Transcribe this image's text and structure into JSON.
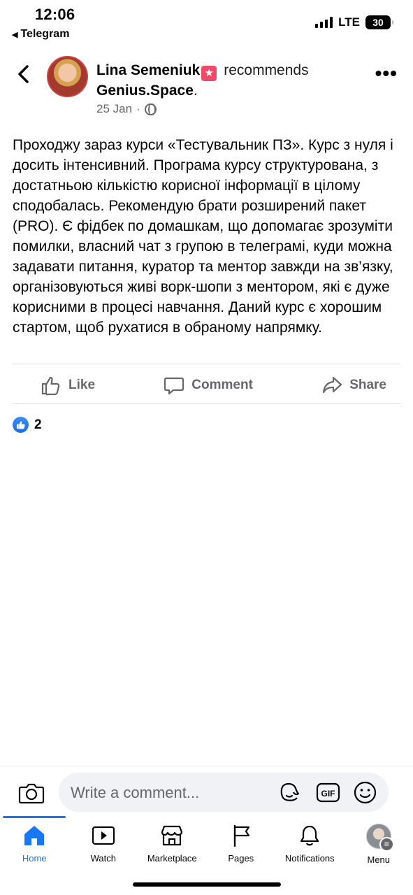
{
  "status_bar": {
    "time": "12:06",
    "back_app": "Telegram",
    "network": "LTE",
    "battery": "30"
  },
  "post": {
    "author": "Lina Semeniuk",
    "action_text": "recommends",
    "page_name": "Genius.Space",
    "date": "25 Jan",
    "separator": "·",
    "body": "Проходжу зараз курси «Тестувальник ПЗ». Курс з нуля і досить інтенсивний. Програма курсу структурована, з достатньою кількістю корисної інформації в цілому сподобалась. Рекомендую брати розширений пакет (PRO). Є фідбек по домашкам, що допомагає зрозуміти помилки, власний чат з групою в телеграмі, куди можна задавати питання, куратор та ментор завжди на зв’язку, організовуються живі ворк-шопи з ментором, які є дуже корисними в процесі навчання. Даний курс є хорошим стартом, щоб рухатися в обраному напрямку."
  },
  "actions": {
    "like": "Like",
    "comment": "Comment",
    "share": "Share"
  },
  "reactions": {
    "count": "2"
  },
  "comment_box": {
    "placeholder": "Write a comment..."
  },
  "tabbar": {
    "home": "Home",
    "watch": "Watch",
    "marketplace": "Marketplace",
    "pages": "Pages",
    "notifications": "Notifications",
    "menu": "Menu"
  },
  "colors": {
    "accent": "#1877f2",
    "secondary_text": "#65676b",
    "badge": "#f04a6a"
  }
}
